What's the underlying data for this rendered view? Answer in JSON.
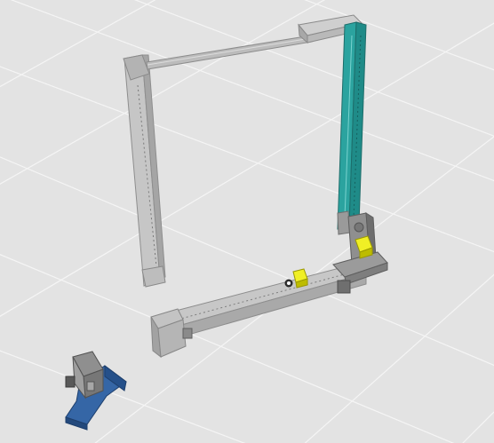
{
  "scene": {
    "background_color": "#e3e3e3",
    "grid_color": "#f4f4f4",
    "objects": [
      {
        "name": "left-vertical-rail",
        "color": "#b8b8b8"
      },
      {
        "name": "top-connecting-rod",
        "color": "#a9a9a9"
      },
      {
        "name": "teal-vertical-rail",
        "color": "#2a9d9a"
      },
      {
        "name": "bottom-horizontal-rail",
        "color": "#b9b9b9"
      },
      {
        "name": "yellow-marker-small",
        "color": "#e4e200"
      },
      {
        "name": "yellow-marker-large",
        "color": "#e4e200"
      },
      {
        "name": "blue-fixture",
        "color": "#3566a6"
      }
    ]
  }
}
